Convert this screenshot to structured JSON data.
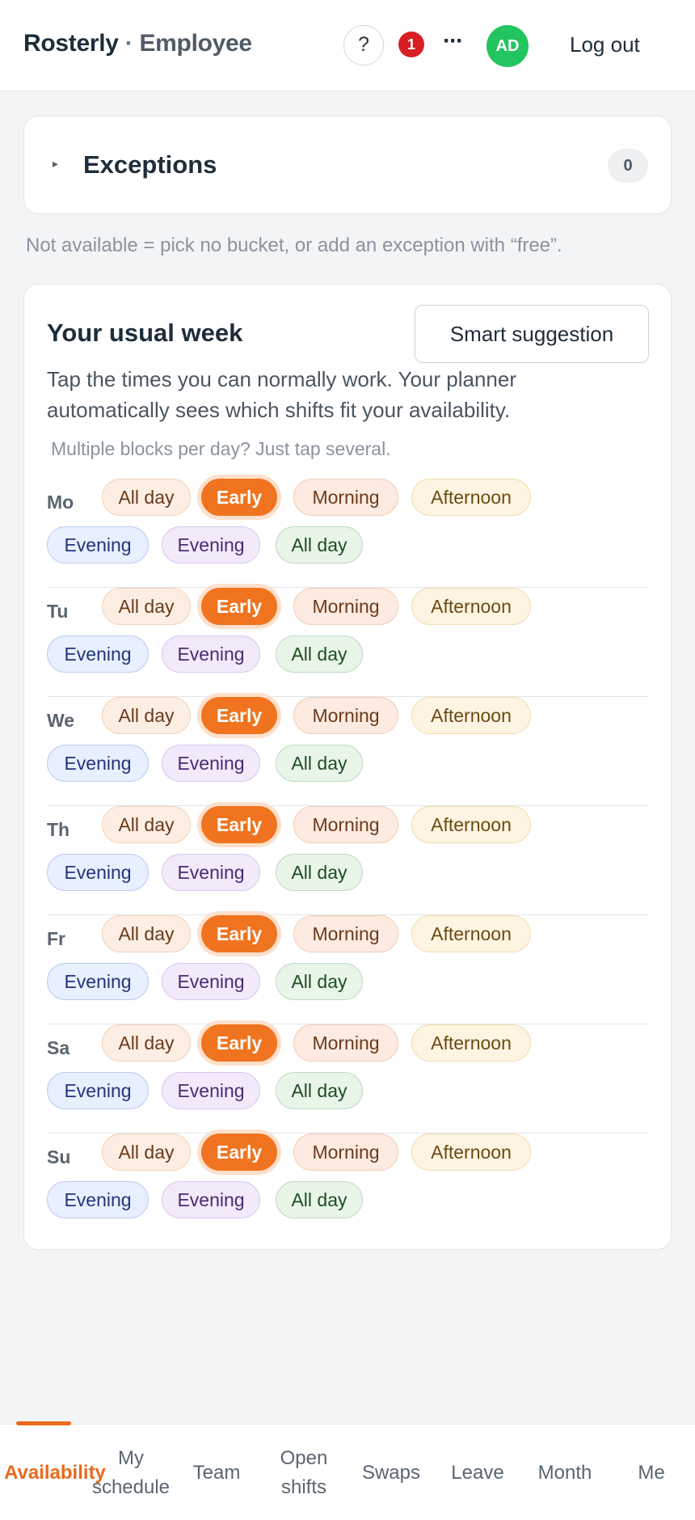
{
  "header": {
    "app_name": "Rosterly",
    "separator": "·",
    "role": "Employee",
    "help_label": "?",
    "notification_count": "1",
    "more_label": "···",
    "avatar_initials": "AD",
    "logout_label": "Log out"
  },
  "exceptions": {
    "caret": "▸",
    "title": "Exceptions",
    "count": "0"
  },
  "hint": "Not available = pick no bucket, or add an exception with “free”.",
  "week": {
    "title": "Your usual week",
    "smart_button": "Smart suggestion",
    "description": "Tap the times you can normally work. Your planner automatically sees which shifts fit your availability.",
    "note": "Multiple blocks per day? Just tap several.",
    "buckets": {
      "allday": "All day",
      "early": "Early",
      "morning": "Morning",
      "afternoon": "Afternoon",
      "evening": "Evening",
      "evening2": "Evening",
      "allday2": "All day"
    },
    "selected_bucket": "Early",
    "days": [
      {
        "label": "Mo"
      },
      {
        "label": "Tu"
      },
      {
        "label": "We"
      },
      {
        "label": "Th"
      },
      {
        "label": "Fr"
      },
      {
        "label": "Sa"
      },
      {
        "label": "Su"
      }
    ]
  },
  "nav": {
    "active": "Availability",
    "items": [
      {
        "label": "Availability"
      },
      {
        "label": "My schedule"
      },
      {
        "label": "Team"
      },
      {
        "label": "Open shifts"
      },
      {
        "label": "Swaps"
      },
      {
        "label": "Leave"
      },
      {
        "label": "Month"
      },
      {
        "label": "Me"
      }
    ]
  },
  "colors": {
    "accent": "#f0741f",
    "avatar": "#22c55e",
    "badge": "#d81f26"
  }
}
